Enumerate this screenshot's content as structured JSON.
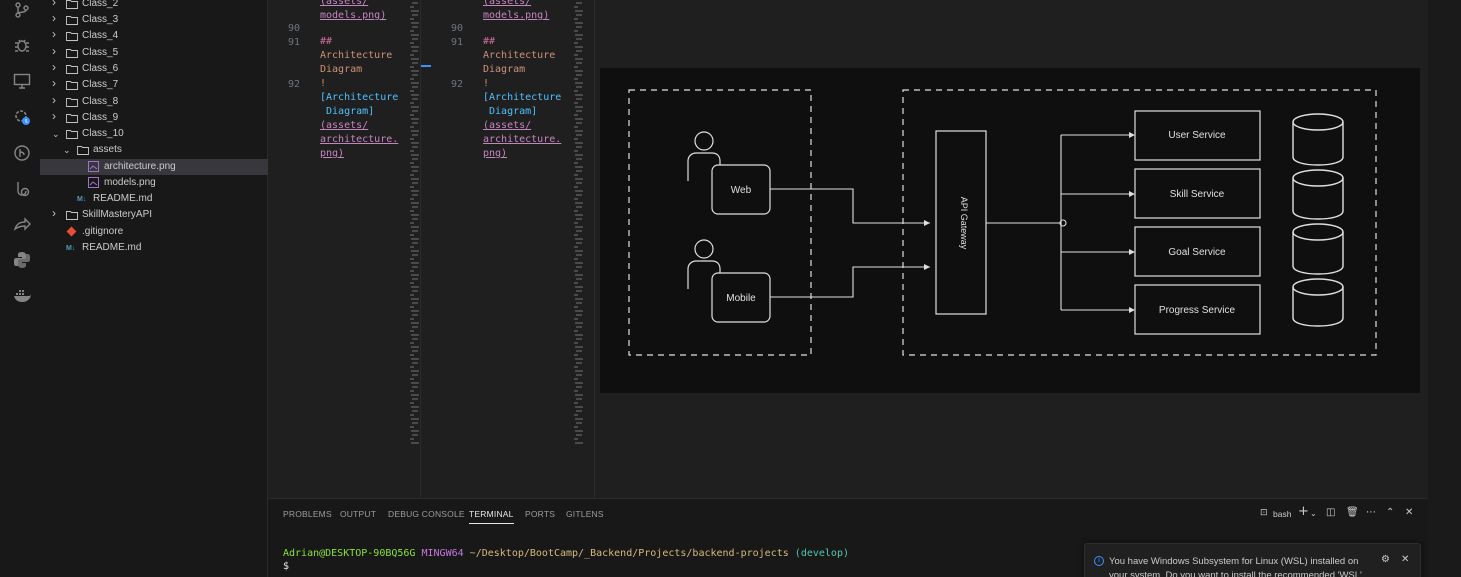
{
  "activity_bar": {
    "icons": [
      "source-control-icon",
      "debug-icon",
      "remote-explorer-icon",
      "settings-sync-icon",
      "gitlens-icon",
      "testing-icon",
      "live-share-icon",
      "python-icon",
      "docker-icon"
    ]
  },
  "explorer": {
    "items": [
      {
        "label": "Class_2",
        "type": "folder",
        "expanded": false
      },
      {
        "label": "Class_3",
        "type": "folder",
        "expanded": false
      },
      {
        "label": "Class_4",
        "type": "folder",
        "expanded": false
      },
      {
        "label": "Class_5",
        "type": "folder",
        "expanded": false
      },
      {
        "label": "Class_6",
        "type": "folder",
        "expanded": false
      },
      {
        "label": "Class_7",
        "type": "folder",
        "expanded": false
      },
      {
        "label": "Class_8",
        "type": "folder",
        "expanded": false
      },
      {
        "label": "Class_9",
        "type": "folder",
        "expanded": false
      },
      {
        "label": "Class_10",
        "type": "folder",
        "expanded": true
      },
      {
        "label": "assets",
        "type": "folder",
        "expanded": true
      },
      {
        "label": "architecture.png",
        "type": "image",
        "selected": true
      },
      {
        "label": "models.png",
        "type": "image"
      },
      {
        "label": "README.md",
        "type": "markdown"
      },
      {
        "label": "SkillMasteryAPI",
        "type": "folder",
        "expanded": false
      },
      {
        "label": ".gitignore",
        "type": "git"
      },
      {
        "label": "README.md",
        "type": "markdown"
      }
    ]
  },
  "editor_left": {
    "lines": [
      {
        "num": "",
        "text": "(assets/",
        "cls": "c-link"
      },
      {
        "num": "",
        "text": "models.png)",
        "cls": "c-link"
      },
      {
        "num": "90",
        "text": "",
        "cls": ""
      },
      {
        "num": "91",
        "text": "##",
        "cls": "c-pink"
      },
      {
        "num": "",
        "text": "Architecture",
        "cls": "c-orange"
      },
      {
        "num": "",
        "text": "Diagram",
        "cls": "c-orange"
      },
      {
        "num": "92",
        "text": "!",
        "cls": "c-orange"
      },
      {
        "num": "",
        "text": "[Architecture",
        "cls": "c-blue"
      },
      {
        "num": "",
        "text": " Diagram]",
        "cls": "c-blue"
      },
      {
        "num": "",
        "text": "(assets/",
        "cls": "c-link"
      },
      {
        "num": "",
        "text": "architecture.",
        "cls": "c-link"
      },
      {
        "num": "",
        "text": "png)",
        "cls": "c-link"
      }
    ]
  },
  "editor_right": {
    "lines": [
      {
        "num": "",
        "text": "(assets/",
        "cls": "c-link"
      },
      {
        "num": "",
        "text": "models.png)",
        "cls": "c-link"
      },
      {
        "num": "90",
        "text": "",
        "cls": ""
      },
      {
        "num": "91",
        "text": "##",
        "cls": "c-pink"
      },
      {
        "num": "",
        "text": "Architecture",
        "cls": "c-orange"
      },
      {
        "num": "",
        "text": "Diagram",
        "cls": "c-orange"
      },
      {
        "num": "92",
        "text": "!",
        "cls": "c-orange"
      },
      {
        "num": "",
        "text": "[Architecture",
        "cls": "c-blue"
      },
      {
        "num": "",
        "text": " Diagram]",
        "cls": "c-blue"
      },
      {
        "num": "",
        "text": "(assets/",
        "cls": "c-link"
      },
      {
        "num": "",
        "text": "architecture.",
        "cls": "c-link"
      },
      {
        "num": "",
        "text": "png)",
        "cls": "c-link"
      }
    ]
  },
  "diagram": {
    "clients": [
      "Web",
      "Mobile"
    ],
    "gateway": "API Gateway",
    "services": [
      "User Service",
      "Skill Service",
      "Goal Service",
      "Progress Service"
    ]
  },
  "panel": {
    "tabs": [
      "PROBLEMS",
      "OUTPUT",
      "DEBUG CONSOLE",
      "TERMINAL",
      "PORTS",
      "GITLENS"
    ],
    "active_tab": "TERMINAL",
    "shell_label": "bash",
    "terminal": {
      "user_host": "Adrian@DESKTOP-90BQ56G",
      "env": "MINGW64",
      "path": "~/Desktop/BootCamp/_Backend/Projects/backend-projects",
      "branch": "(develop)",
      "prompt": "$"
    }
  },
  "notification": {
    "line1": "You have Windows Subsystem for Linux (WSL) installed on",
    "line2": "your system. Do you want to install the recommended 'WSL'"
  },
  "colors": {
    "editor_bg": "#1f1f1f",
    "sidebar_bg": "#181818",
    "selection": "#37373d",
    "accent_blue": "#3794ff"
  }
}
